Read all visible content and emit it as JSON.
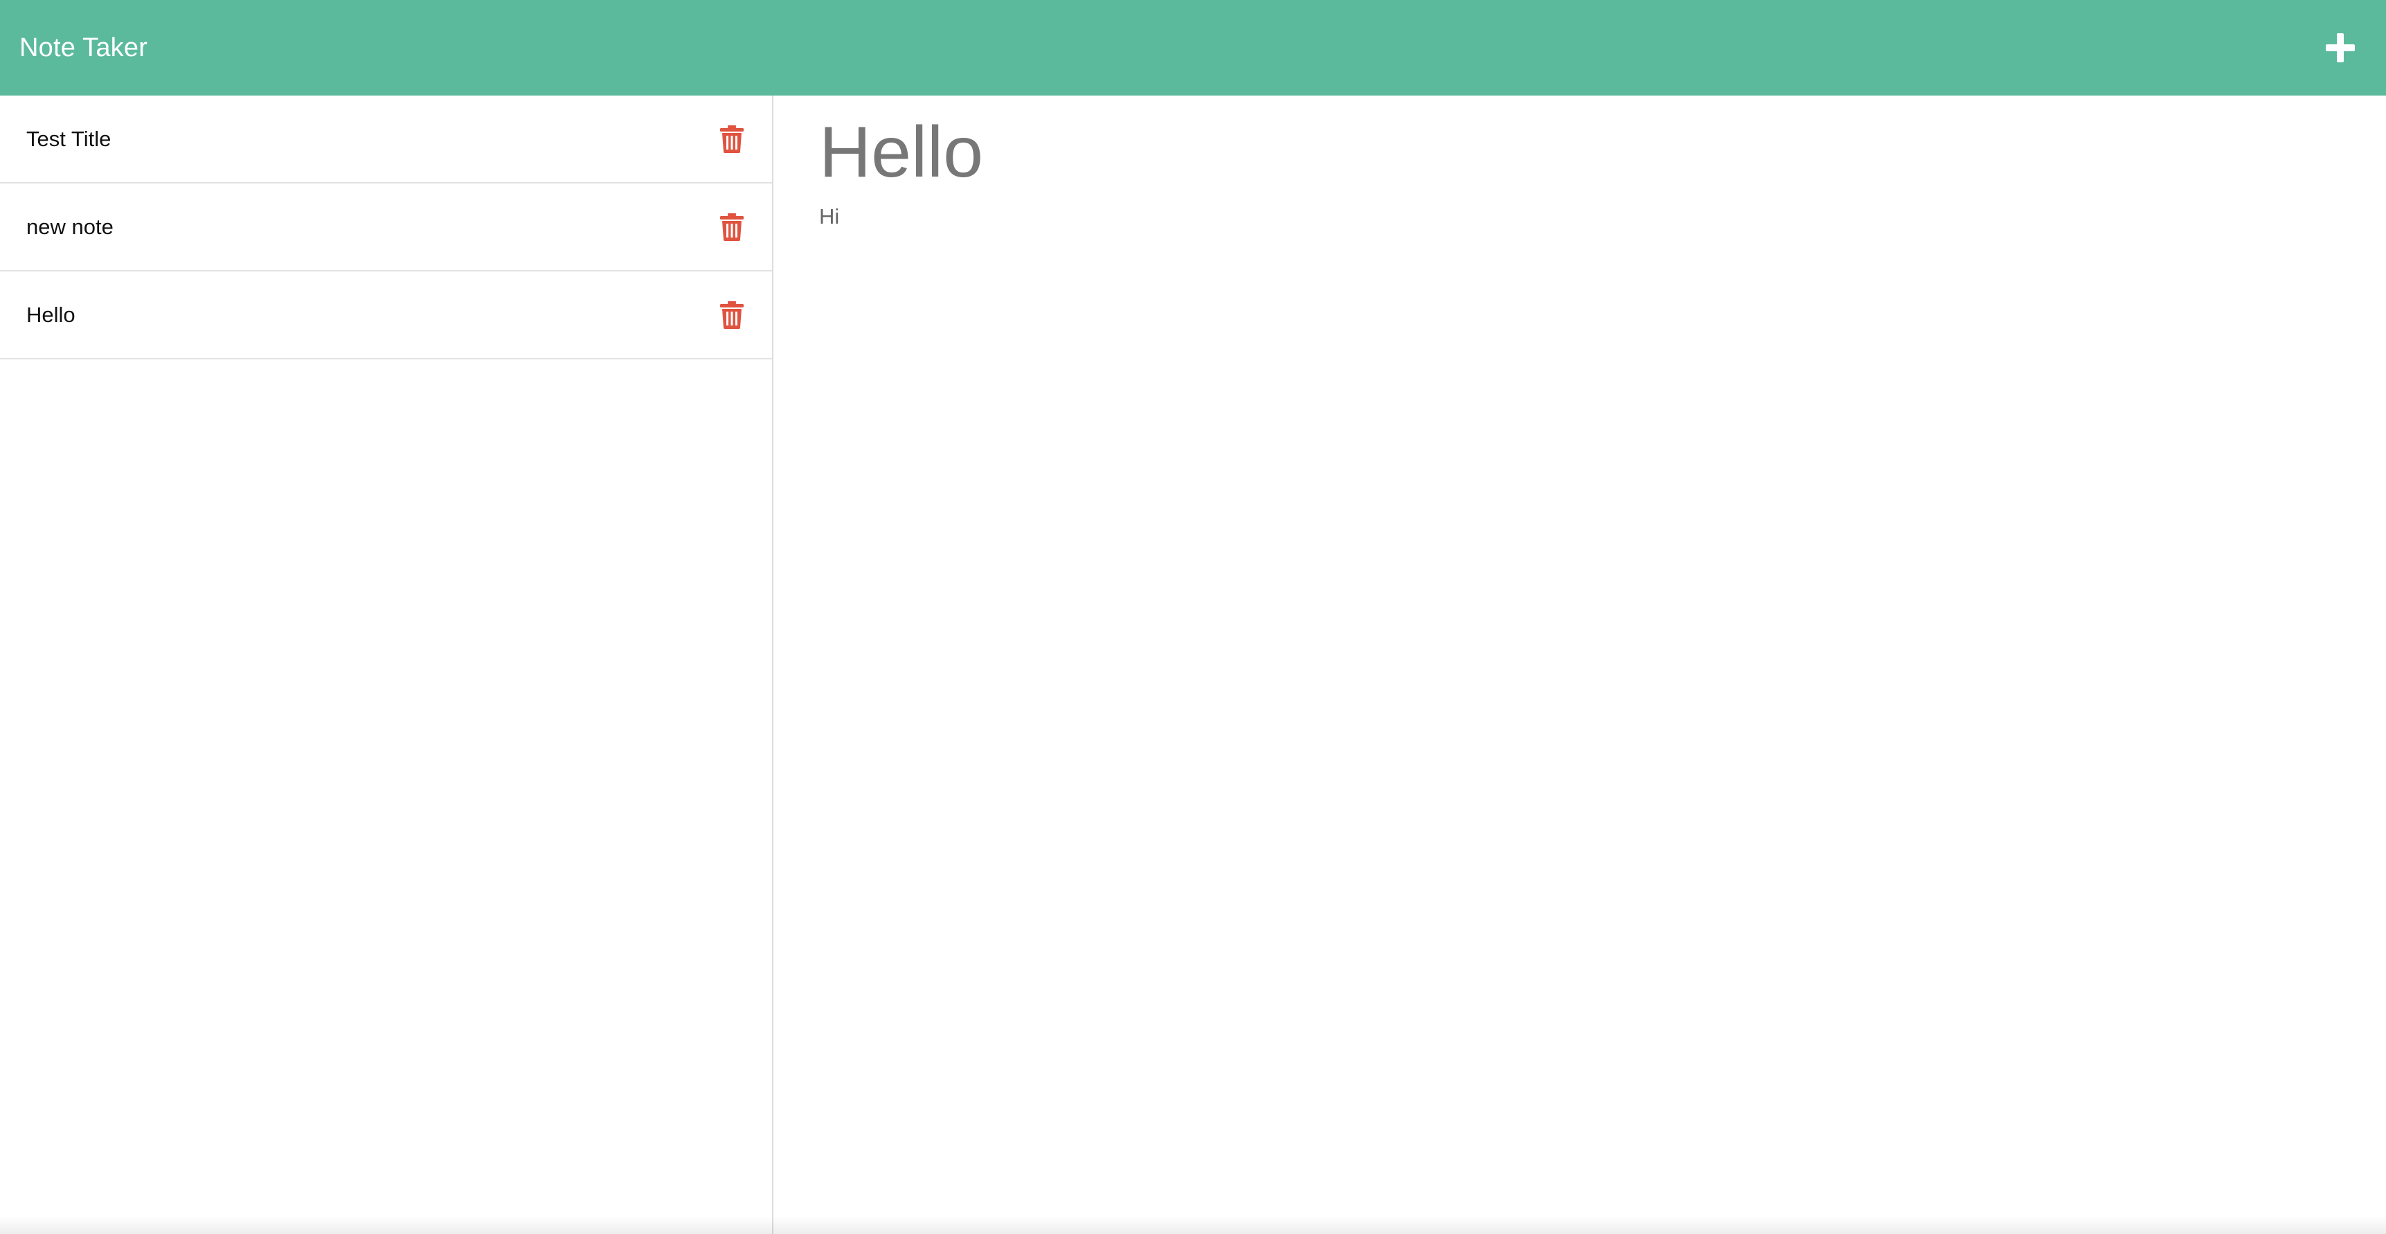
{
  "header": {
    "brand": "Note Taker",
    "add_icon": "plus-icon",
    "background_color": "#5bba9c"
  },
  "sidebar": {
    "notes": [
      {
        "title": "Test Title",
        "delete_icon": "trash-icon"
      },
      {
        "title": "new note",
        "delete_icon": "trash-icon"
      },
      {
        "title": "Hello",
        "delete_icon": "trash-icon"
      }
    ],
    "delete_icon_color": "#e0533f"
  },
  "editor": {
    "title": "Hello",
    "body": "Hi"
  }
}
